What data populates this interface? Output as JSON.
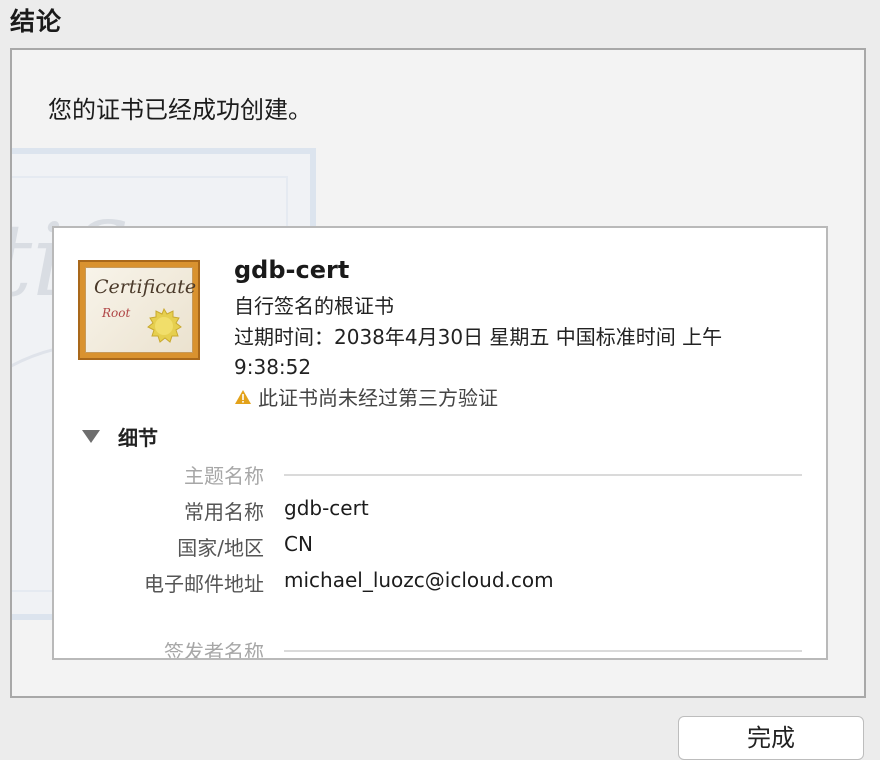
{
  "page": {
    "title": "结论"
  },
  "message": "您的证书已经成功创建。",
  "background_cert": {
    "script_text": "tifi"
  },
  "certificate": {
    "icon": {
      "name": "certificate-icon",
      "word": "Certificate",
      "sub": "Root"
    },
    "name": "gdb-cert",
    "kind": "自行签名的根证书",
    "expiry": "过期时间：2038年4月30日 星期五 中国标准时间 上午 9:38:52",
    "warning": "此证书尚未经过第三方验证",
    "warning_icon": "warning-triangle-icon",
    "warning_color": "#e3a21a"
  },
  "details": {
    "toggle_label": "细节",
    "toggle_icon": "triangle-down-icon",
    "subject_header": "主题名称",
    "rows": [
      {
        "label": "常用名称",
        "value": "gdb-cert"
      },
      {
        "label": "国家/地区",
        "value": "CN"
      },
      {
        "label": "电子邮件地址",
        "value": "michael_luozc@icloud.com"
      }
    ],
    "issuer_header": "签发者名称"
  },
  "footer": {
    "done_label": "完成"
  }
}
